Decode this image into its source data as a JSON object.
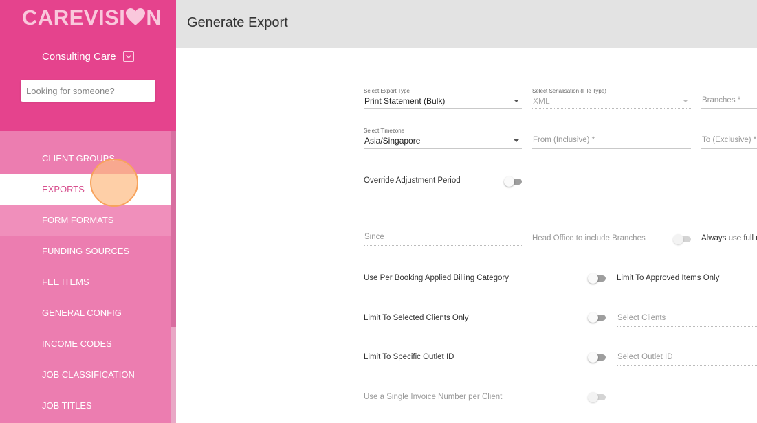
{
  "brand": {
    "name_pre": "CAREVISI",
    "name_post": "N",
    "heart_color": "#f9c8dc"
  },
  "account": {
    "name": "Consulting Care"
  },
  "search": {
    "placeholder": "Looking for someone?"
  },
  "nav": {
    "items": [
      {
        "label": "CLIENT GROUPS",
        "state": "normal"
      },
      {
        "label": "EXPORTS",
        "state": "active"
      },
      {
        "label": "FORM FORMATS",
        "state": "hover"
      },
      {
        "label": "FUNDING SOURCES",
        "state": "normal"
      },
      {
        "label": "FEE ITEMS",
        "state": "normal"
      },
      {
        "label": "GENERAL CONFIG",
        "state": "normal"
      },
      {
        "label": "INCOME CODES",
        "state": "normal"
      },
      {
        "label": "JOB CLASSIFICATION",
        "state": "normal"
      },
      {
        "label": "JOB TITLES",
        "state": "normal"
      }
    ]
  },
  "header": {
    "title": "Generate Export"
  },
  "form": {
    "export_type": {
      "label": "Select Export Type",
      "value": "Print Statement (Bulk)"
    },
    "serialisation": {
      "label": "Select Serialisation (File Type)",
      "value": "XML"
    },
    "branches": {
      "placeholder": "Branches *"
    },
    "timezone": {
      "label": "Select Timezone",
      "value": "Asia/Singapore"
    },
    "from": {
      "placeholder": "From (Inclusive) *"
    },
    "to": {
      "placeholder": "To (Exclusive) *"
    },
    "override_adjustment": {
      "label": "Override Adjustment Period"
    },
    "since": {
      "placeholder": "Since"
    },
    "head_office": {
      "label": "Head Office to include Branches"
    },
    "always_use_full": {
      "label": "Always use full r"
    },
    "per_booking": {
      "label": "Use Per Booking Applied Billing Category"
    },
    "approved_only": {
      "label": "Limit To Approved Items Only"
    },
    "selected_clients": {
      "label": "Limit To Selected Clients Only",
      "placeholder": "Select Clients"
    },
    "specific_outlet": {
      "label": "Limit To Specific Outlet ID",
      "placeholder": "Select Outlet ID"
    },
    "single_invoice": {
      "label": "Use a Single Invoice Number per Client"
    }
  },
  "colors": {
    "sidebar_top": "#e5438d",
    "sidebar": "#ec7db0",
    "active_text": "#d74f8e"
  }
}
